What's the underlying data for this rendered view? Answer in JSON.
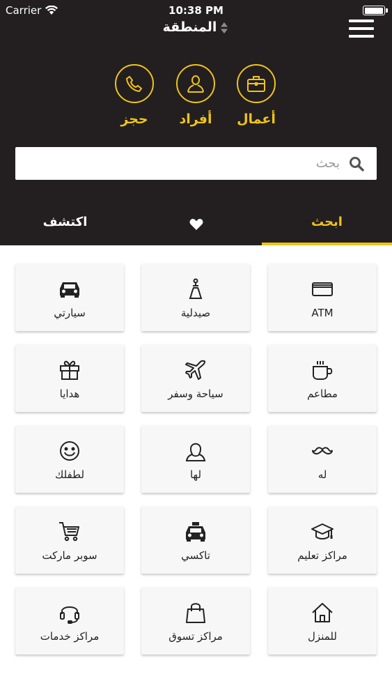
{
  "status_bar": {
    "carrier": "Carrier",
    "time": "10:38 PM"
  },
  "header": {
    "region_label": "المنطقة"
  },
  "quick_actions": [
    {
      "label": "أعمال",
      "icon": "briefcase-icon"
    },
    {
      "label": "أفراد",
      "icon": "person-icon"
    },
    {
      "label": "حجز",
      "icon": "phone-icon"
    }
  ],
  "search": {
    "placeholder": "بحث",
    "value": ""
  },
  "tabs": {
    "search": "ابحث",
    "favorites_icon": "heart-icon",
    "discover": "اكتشف"
  },
  "categories": [
    {
      "label": "ATM",
      "icon": "credit-card-icon"
    },
    {
      "label": "صيدلية",
      "icon": "pharmacy-icon"
    },
    {
      "label": "سيارتي",
      "icon": "car-icon"
    },
    {
      "label": "مطاعم",
      "icon": "coffee-cup-icon"
    },
    {
      "label": "سياحة وسفر",
      "icon": "airplane-icon"
    },
    {
      "label": "هدايا",
      "icon": "gift-icon"
    },
    {
      "label": "له",
      "icon": "mustache-icon"
    },
    {
      "label": "لها",
      "icon": "woman-icon"
    },
    {
      "label": "لطفلك",
      "icon": "smiley-icon"
    },
    {
      "label": "مراكز تعليم",
      "icon": "graduation-cap-icon"
    },
    {
      "label": "تاكسي",
      "icon": "taxi-icon"
    },
    {
      "label": "سوبر ماركت",
      "icon": "shopping-cart-icon"
    },
    {
      "label": "للمنزل",
      "icon": "house-icon"
    },
    {
      "label": "مراكز تسوق",
      "icon": "shopping-bag-icon"
    },
    {
      "label": "مراكز خدمات",
      "icon": "headset-icon"
    }
  ],
  "colors": {
    "header_bg": "#231f20",
    "accent": "#f0c419",
    "card_bg": "#f7f7f8"
  }
}
